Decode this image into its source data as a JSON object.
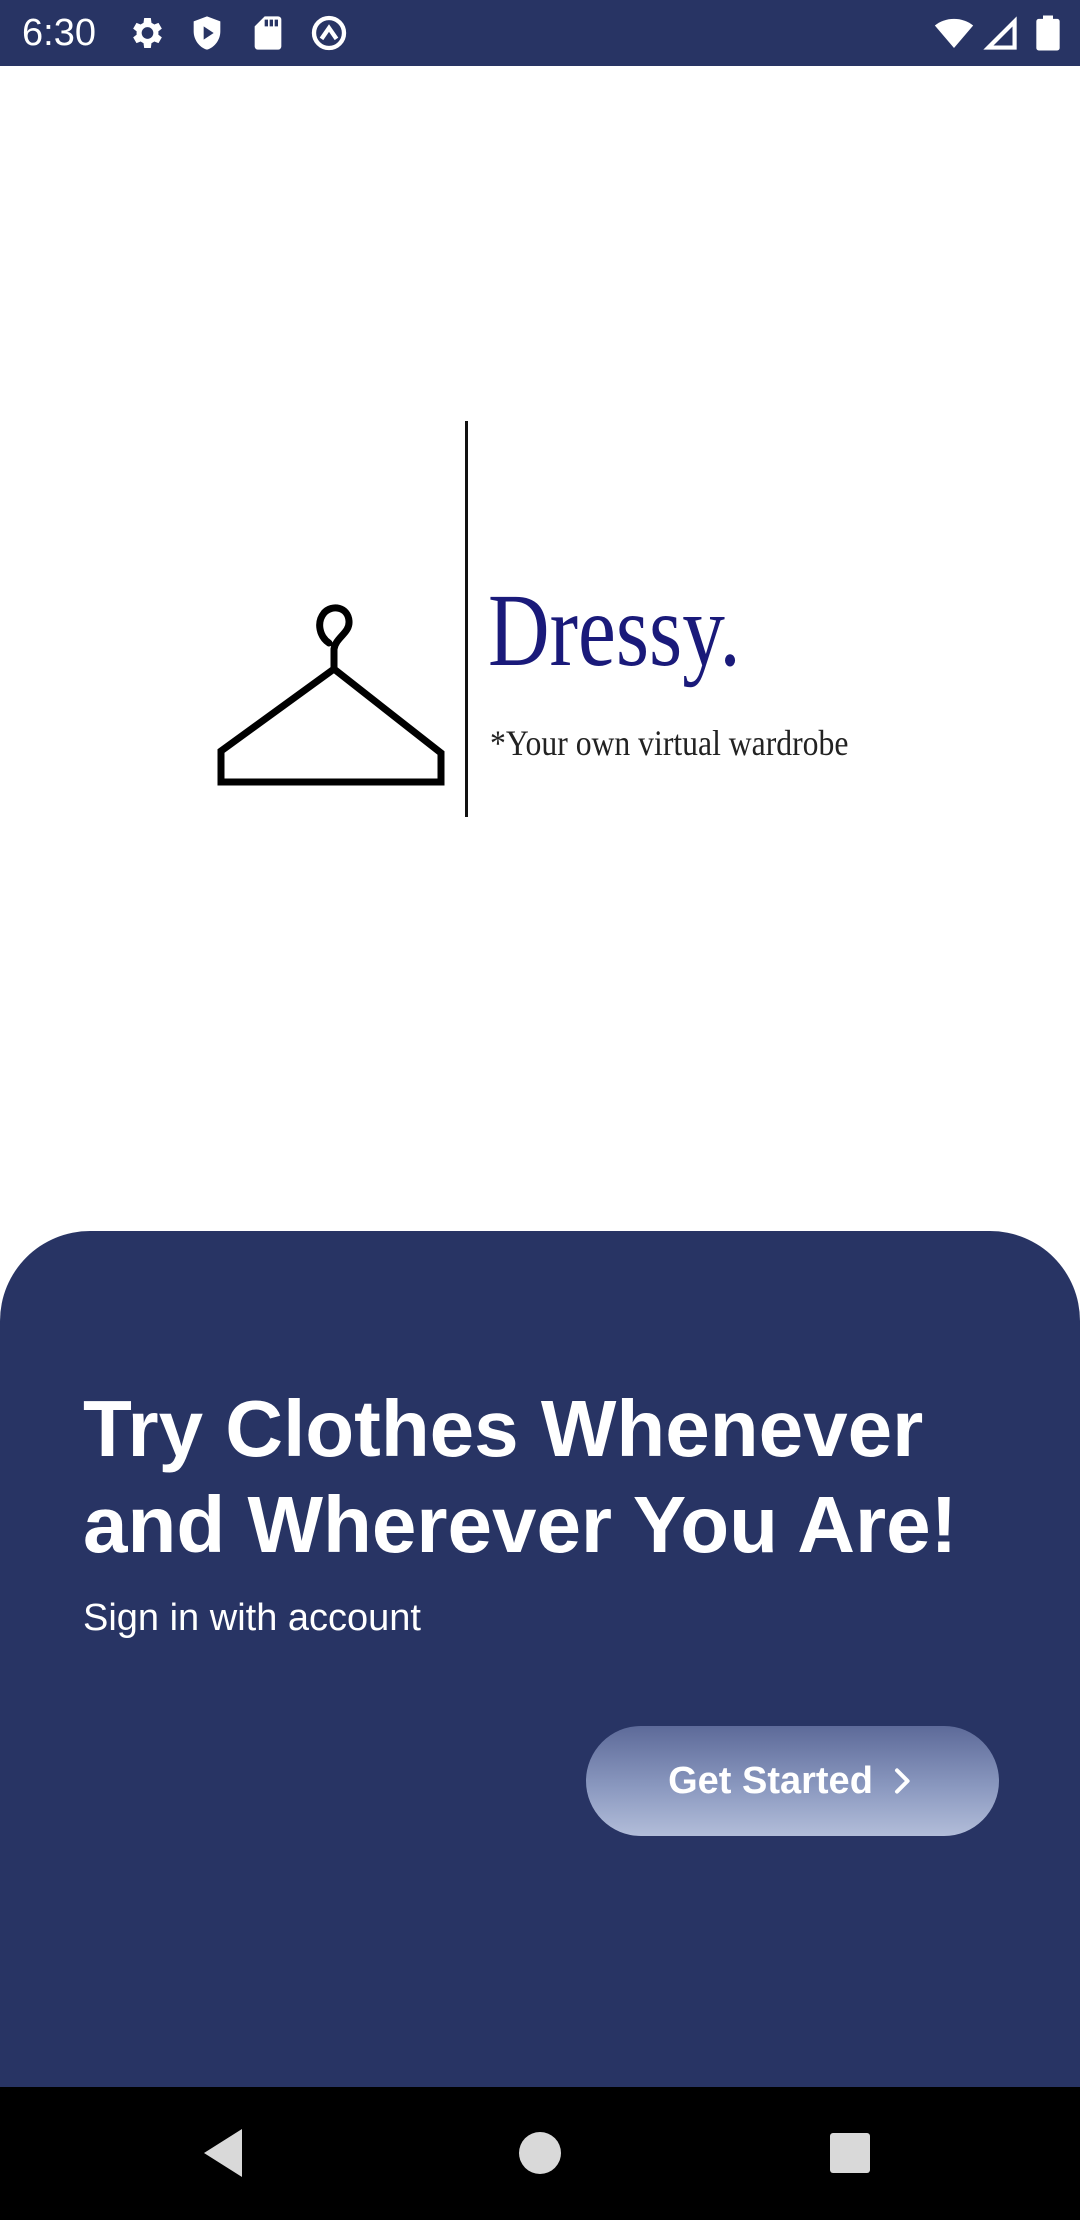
{
  "status_bar": {
    "time": "6:30",
    "background": "#283464",
    "left_icons": [
      "gear-icon",
      "shield-play-icon",
      "sd-card-icon",
      "at-sign-icon"
    ],
    "right_icons": [
      "wifi-icon",
      "signal-icon",
      "battery-icon"
    ]
  },
  "logo": {
    "brand_name": "Dressy.",
    "tagline": "*Your own virtual wardrobe",
    "icon": "hanger-icon",
    "brand_color": "#1a1a7a"
  },
  "panel": {
    "headline": "Try Clothes Whenever and Wherever You Are!",
    "subtitle": "Sign in with account",
    "button_label": "Get Started",
    "button_icon": "chevron-right-icon",
    "background": "#283464"
  },
  "nav_bar": {
    "buttons": [
      "back-icon",
      "home-icon",
      "recents-icon"
    ]
  }
}
